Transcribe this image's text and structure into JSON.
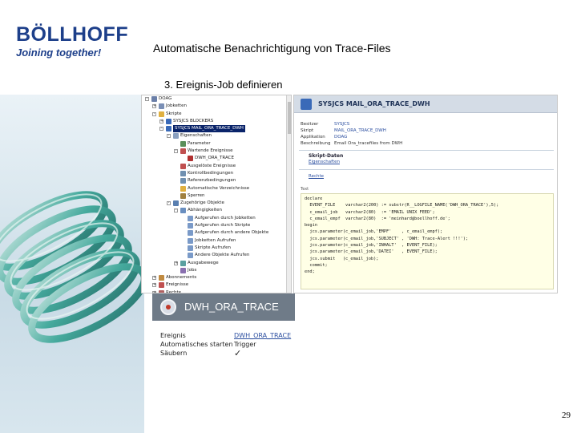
{
  "logo": {
    "name": "BÖLLHOFF",
    "slogan": "Joining together!"
  },
  "title": "Automatische Benachrichtigung von Trace-Files",
  "subheading": "3. Ereignis-Job definieren",
  "tree": {
    "items": [
      {
        "label": "DOAG",
        "level": 0,
        "expander": "-",
        "icon": "db-icon"
      },
      {
        "label": "Jobketten",
        "level": 1,
        "expander": "+",
        "icon": "chain-icon"
      },
      {
        "label": "Skripte",
        "level": 1,
        "expander": "-",
        "icon": "folder-icon"
      },
      {
        "label": "SYSJCS BLOCKERS",
        "level": 2,
        "expander": "+",
        "icon": "script-icon"
      },
      {
        "label": "SYSJCS MAIL_ORA_TRACE_DWH",
        "level": 2,
        "expander": "-",
        "icon": "script-icon",
        "selected": true
      },
      {
        "label": "Eigenschaften",
        "level": 3,
        "expander": "-",
        "icon": "properties-icon"
      },
      {
        "label": "Parameter",
        "level": 4,
        "expander": "",
        "icon": "parameter-icon"
      },
      {
        "label": "Wartende Ereignisse",
        "level": 4,
        "expander": "-",
        "icon": "event-icon"
      },
      {
        "label": "DWH_ORA_TRACE",
        "level": 5,
        "expander": "",
        "icon": "event-item-icon"
      },
      {
        "label": "Ausgelöste Ereignisse",
        "level": 4,
        "expander": "",
        "icon": "event-icon"
      },
      {
        "label": "Kontrollbedingungen",
        "level": 4,
        "expander": "",
        "icon": "condition-icon"
      },
      {
        "label": "Referenzbedingungen",
        "level": 4,
        "expander": "",
        "icon": "condition-icon"
      },
      {
        "label": "Automatische Verzeichnisse",
        "level": 4,
        "expander": "",
        "icon": "folder-icon"
      },
      {
        "label": "Sperren",
        "level": 4,
        "expander": "",
        "icon": "lock-icon"
      },
      {
        "label": "Zugehörige Objekte",
        "level": 3,
        "expander": "-",
        "icon": "related-icon"
      },
      {
        "label": "Abhängigkeiten",
        "level": 4,
        "expander": "-",
        "icon": "dependency-icon"
      },
      {
        "label": "Aufgerufen durch Jobketten",
        "level": 5,
        "expander": "",
        "icon": "link-icon"
      },
      {
        "label": "Aufgerufen durch Skripte",
        "level": 5,
        "expander": "",
        "icon": "link-icon"
      },
      {
        "label": "Aufgerufen durch andere Objekte",
        "level": 5,
        "expander": "",
        "icon": "link-icon"
      },
      {
        "label": "Jobketten Aufrufen",
        "level": 5,
        "expander": "",
        "icon": "link-icon"
      },
      {
        "label": "Skripte Aufrufen",
        "level": 5,
        "expander": "",
        "icon": "link-icon"
      },
      {
        "label": "Andere Objekte Aufrufen",
        "level": 5,
        "expander": "",
        "icon": "link-icon"
      },
      {
        "label": "Ausgabewege",
        "level": 4,
        "expander": "+",
        "icon": "output-icon"
      },
      {
        "label": "Jobs",
        "level": 4,
        "expander": "",
        "icon": "job-icon"
      },
      {
        "label": "Abonnements",
        "level": 1,
        "expander": "+",
        "icon": "subscription-icon"
      },
      {
        "label": "Ereignisse",
        "level": 1,
        "expander": "+",
        "icon": "event-icon"
      },
      {
        "label": "Rechte",
        "level": 1,
        "expander": "+",
        "icon": "rights-icon"
      }
    ]
  },
  "script": {
    "header_title": "SYSJCS MAIL_ORA_TRACE_DWH",
    "properties": [
      {
        "key": "Besitzer",
        "value": "SYSJCS"
      },
      {
        "key": "Skript",
        "value": "MAIL_ORA_TRACE_DWH"
      },
      {
        "key": "Applikation",
        "value": "DOAG"
      },
      {
        "key": "Beschreibung",
        "value": "Email Ora_tracefiles from DWH"
      }
    ],
    "section1_title": "Skript-Daten",
    "section1_link": "Eigenschaften",
    "section2_link": "Rechte",
    "code_label": "Text",
    "code_lines": [
      "declare",
      "  EVENT_FILE    varchar2(200) := substr(R__LOGFILE_NAME('DWH_ORA_TRACE'),5);",
      "  c_email_job   varchar2(80)  := 'EMAIL UNIX FEED';",
      "  c_email_empf  varchar2(80)  := 'meinhard@boellhoff.de';",
      "begin",
      "  jcs.parameter(c_email_job,'EMPF'    , c_email_empf);",
      "  jcs.parameter(c_email_job,'SUBJECT' , 'DWH: Trace-Alert !!!');",
      "  jcs.parameter(c_email_job,'INHALT'  , EVENT_FILE);",
      "  jcs.parameter(c_email_job,'DATEI'   , EVENT_FILE);",
      "  jcs.submit   (c_email_job);",
      "  commit;",
      "end;"
    ]
  },
  "job": {
    "title": "DWH_ORA_TRACE",
    "rows": [
      {
        "key": "Ereignis",
        "value": "DWH_ORA_TRACE",
        "link": true
      },
      {
        "key": "Automatisches starten",
        "value": "Trigger",
        "link": false
      },
      {
        "key": "Säubern",
        "value": "✓",
        "link": false
      }
    ]
  },
  "page_number": "29",
  "colors": {
    "brand_blue": "#1d3f8a",
    "selection": "#0a246a",
    "link": "#2c4fa0",
    "job_header": "#6f7b88"
  }
}
